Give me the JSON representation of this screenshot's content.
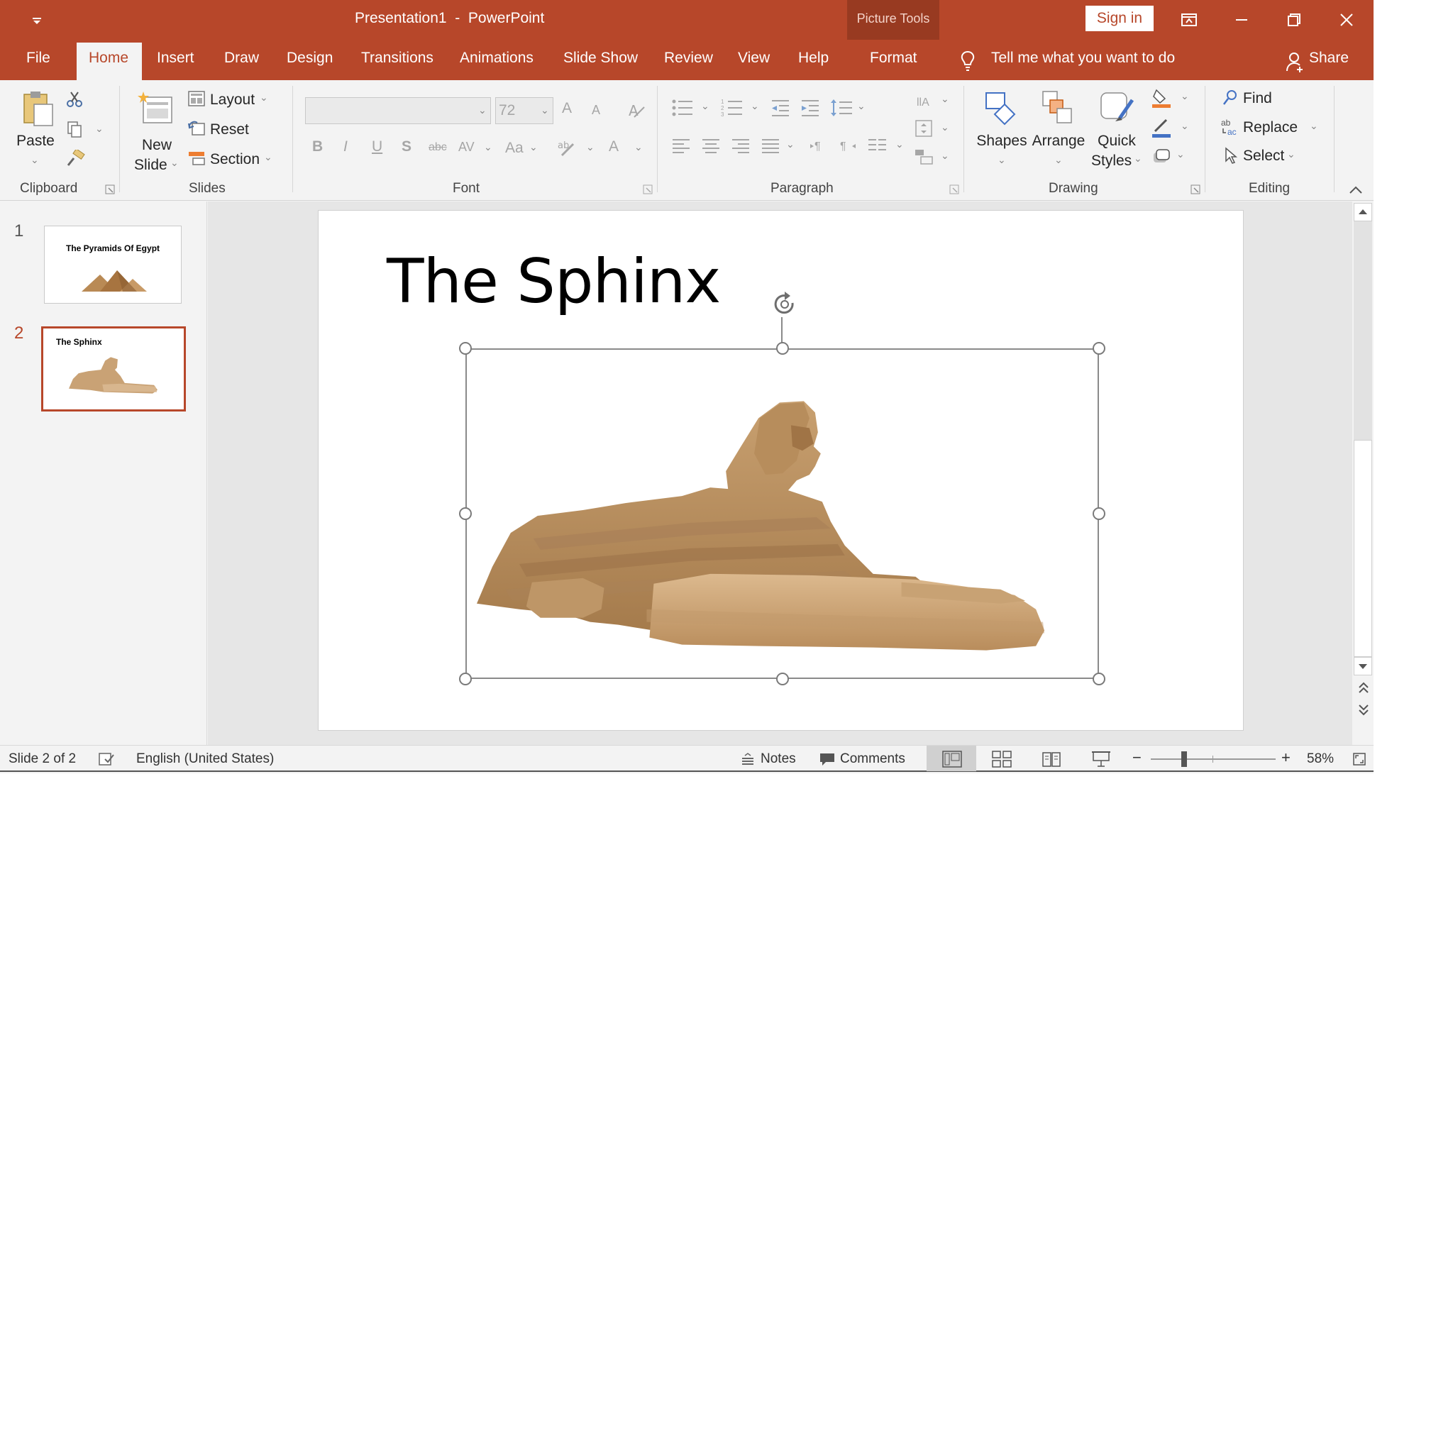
{
  "titlebar": {
    "document_name": "Presentation1  -  PowerPoint",
    "contextual_group": "Picture Tools",
    "sign_in": "Sign in"
  },
  "tabs": {
    "file": "File",
    "home": "Home",
    "insert": "Insert",
    "draw": "Draw",
    "design": "Design",
    "transitions": "Transitions",
    "animations": "Animations",
    "slide_show": "Slide Show",
    "review": "Review",
    "view": "View",
    "help": "Help",
    "format": "Format",
    "tell_me": "Tell me what you want to do",
    "share": "Share"
  },
  "ribbon": {
    "clipboard": {
      "label": "Clipboard",
      "paste": "Paste"
    },
    "slides": {
      "label": "Slides",
      "new_slide_line1": "New",
      "new_slide_line2": "Slide",
      "layout": "Layout",
      "reset": "Reset",
      "section": "Section"
    },
    "font": {
      "label": "Font",
      "font_name": "",
      "font_size": "72",
      "bold": "B",
      "italic": "I",
      "underline": "U",
      "shadow": "S",
      "strike": "abc",
      "spacing": "AV",
      "case": "Aa",
      "color": "A",
      "grow": "A",
      "shrink": "A"
    },
    "paragraph": {
      "label": "Paragraph"
    },
    "drawing": {
      "label": "Drawing",
      "shapes": "Shapes",
      "arrange": "Arrange",
      "quick_line1": "Quick",
      "quick_line2": "Styles",
      "fill_color": "#ed7d31",
      "outline_color": "#4472c4"
    },
    "editing": {
      "label": "Editing",
      "find": "Find",
      "replace": "Replace",
      "select": "Select"
    }
  },
  "thumbnails": [
    {
      "number": "1",
      "title": "The Pyramids Of Egypt"
    },
    {
      "number": "2",
      "title": "The Sphinx"
    }
  ],
  "slide": {
    "title": "The Sphinx"
  },
  "status": {
    "slide_counter": "Slide 2 of 2",
    "language": "English (United States)",
    "notes": "Notes",
    "comments": "Comments",
    "zoom": "58%",
    "zoom_fraction": 0.58
  },
  "colors": {
    "accent": "#b7472a",
    "accent_dark": "#983a21",
    "ribbon_bg": "#f3f3f3",
    "selection": "#b7472a"
  }
}
